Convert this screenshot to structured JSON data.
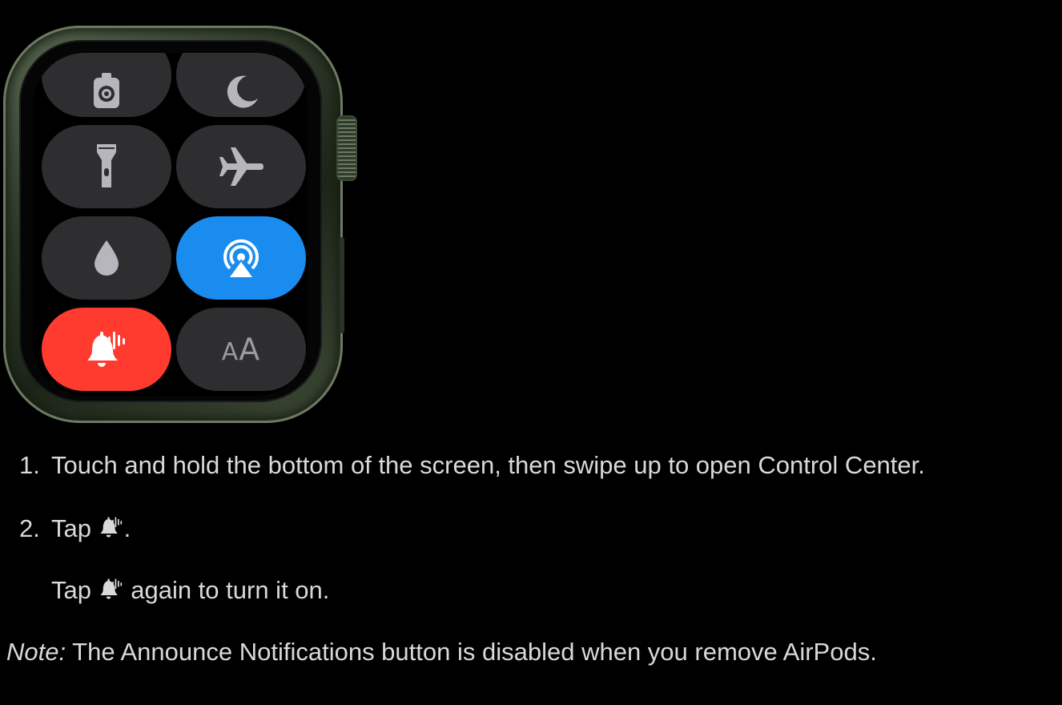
{
  "controls": [
    {
      "name": "walkie-talkie",
      "icon": "walkie-talkie-icon",
      "state": "off"
    },
    {
      "name": "do-not-disturb",
      "icon": "moon-icon",
      "state": "off"
    },
    {
      "name": "flashlight",
      "icon": "flashlight-icon",
      "state": "off"
    },
    {
      "name": "airplane-mode",
      "icon": "airplane-icon",
      "state": "off"
    },
    {
      "name": "water-lock",
      "icon": "water-drop-icon",
      "state": "off"
    },
    {
      "name": "airplay",
      "icon": "airplay-icon",
      "state": "on"
    },
    {
      "name": "announce-notifications",
      "icon": "announce-notifications-bell-icon",
      "state": "on"
    },
    {
      "name": "text-size",
      "icon": "text-size-icon",
      "label": "AA",
      "state": "off"
    }
  ],
  "colors": {
    "background": "#000000",
    "tile": "#2e2e30",
    "tile_active_blue": "#1a8cf0",
    "tile_active_red": "#ff3b30",
    "watch_case": "#3e4a37",
    "text": "#d9d9d9"
  },
  "instructions": {
    "step1_number": "1.",
    "step1_text": "Touch and hold the bottom of the screen, then swipe up to open Control Center.",
    "step2_number": "2.",
    "step2_prefix": "Tap ",
    "step2_suffix": ".",
    "step2b_prefix": "Tap ",
    "step2b_suffix": " again to turn it on.",
    "note_label": "Note:",
    "note_text": " The Announce Notifications button is disabled when you remove AirPods."
  }
}
